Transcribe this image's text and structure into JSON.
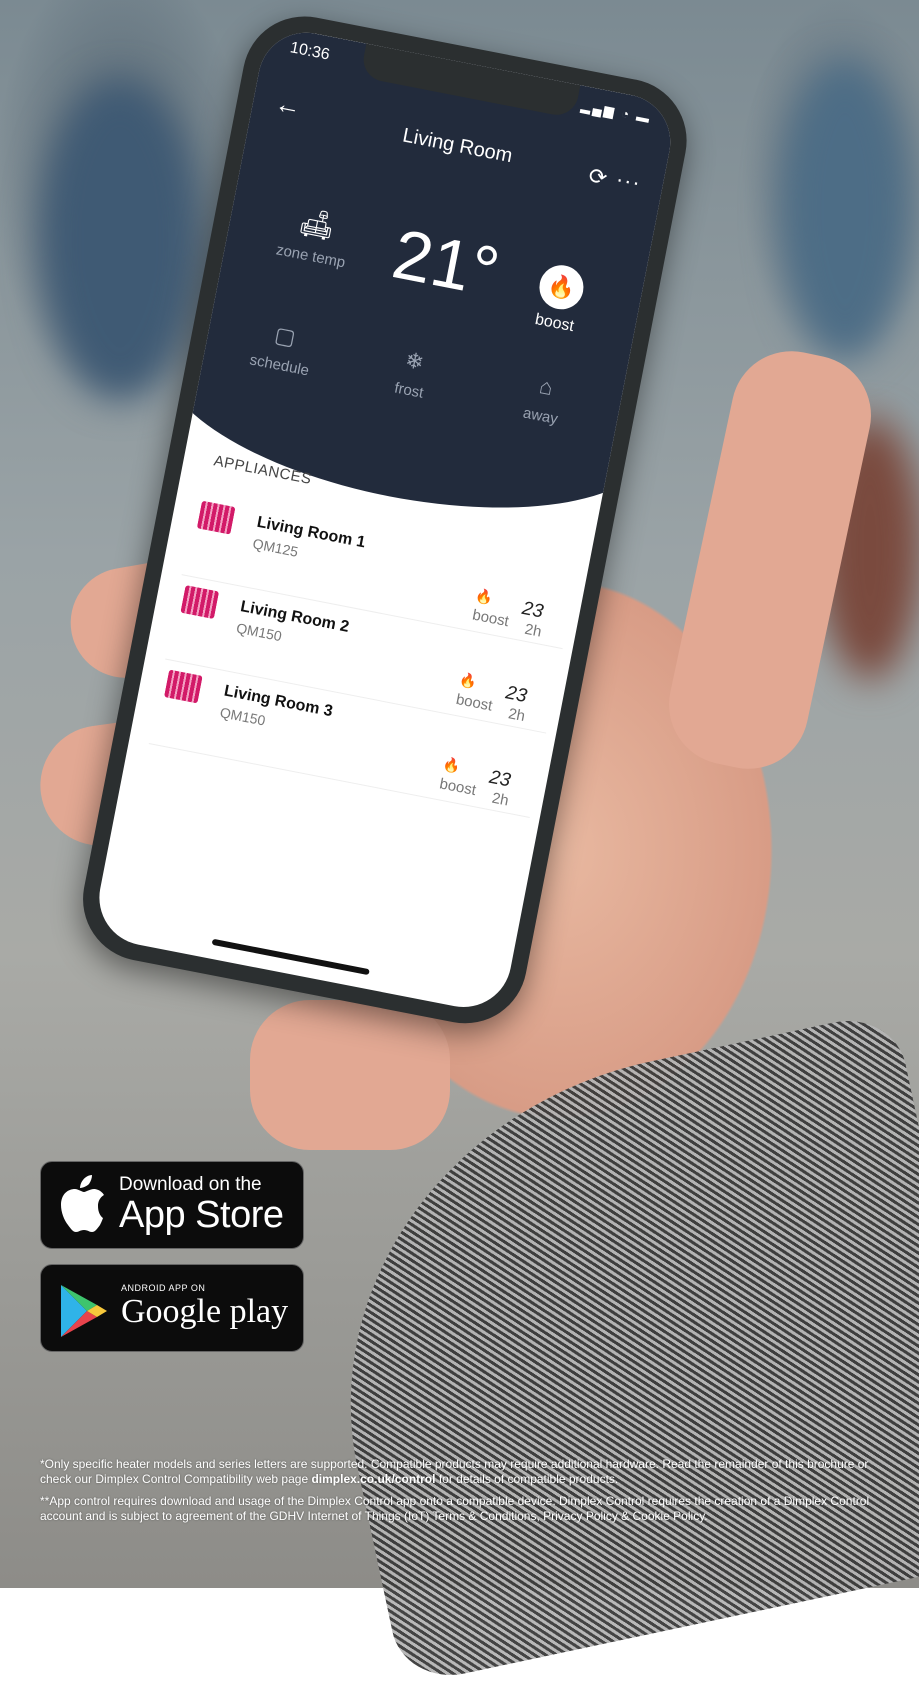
{
  "phone": {
    "status_time": "10:36",
    "status_icons": "▂▄▆ ◔ ▬",
    "back_icon": "←",
    "title": "Living Room",
    "sync_icon": "⟳",
    "more_icon": "···",
    "zone_temp": {
      "icon": "chair-icon",
      "label": "zone temp"
    },
    "temperature": "21°",
    "boost": {
      "label": "boost",
      "icon": "flame-icon"
    },
    "modes": [
      {
        "label": "schedule",
        "icon": "calendar-icon"
      },
      {
        "label": "frost",
        "icon": "snowflake-icon"
      },
      {
        "label": "away",
        "icon": "home-exit-icon"
      }
    ],
    "appliances_heading": "APPLIANCES",
    "appliances": [
      {
        "name": "Living Room 1",
        "model": "QM125",
        "mode": "boost",
        "temp": "23",
        "time": "2h"
      },
      {
        "name": "Living Room 2",
        "model": "QM150",
        "mode": "boost",
        "temp": "23",
        "time": "2h"
      },
      {
        "name": "Living Room 3",
        "model": "QM150",
        "mode": "boost",
        "temp": "23",
        "time": "2h"
      }
    ]
  },
  "badges": {
    "app_store": {
      "small": "Download on the",
      "big": "App Store"
    },
    "google_play": {
      "small": "ANDROID APP ON",
      "big": "Google play"
    }
  },
  "footnotes": {
    "note1_pre": "*Only specific heater models and series letters are supported. Compatible products may require additional hardware. Read the remainder of this brochure or check our Dimplex Control Compatibility web page ",
    "note1_link": "dimplex.co.uk/control",
    "note1_post": " for details of compatible products.",
    "note2": "**App control requires download and usage of the Dimplex Control app onto a compatible device. Dimplex Control requires the creation of a Dimplex Control account and is subject to agreement of the GDHV Internet of Things (IoT) Terms & Conditions, Privacy Policy & Cookie Policy."
  },
  "colors": {
    "app_dark": "#222b3c",
    "radiator_pink": "#d21a68",
    "boost_red": "#e0482a"
  }
}
